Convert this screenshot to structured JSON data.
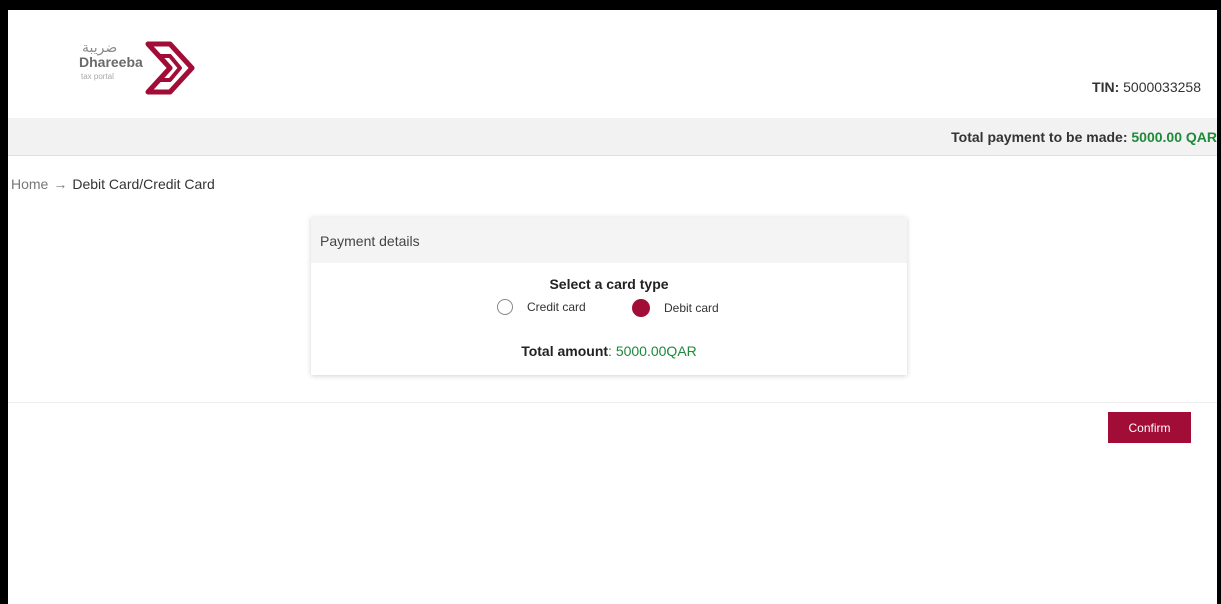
{
  "header": {
    "logo": {
      "arabic": "ضريبة",
      "name": "Dhareeba",
      "subtitle": "tax portal"
    },
    "tin_label": "TIN:",
    "tin_value": "5000033258"
  },
  "payment_bar": {
    "label": "Total payment to be made:",
    "amount": "5000.00 QAR"
  },
  "breadcrumb": {
    "home": "Home",
    "arrow": "→",
    "current": "Debit Card/Credit Card"
  },
  "card": {
    "title": "Payment details",
    "select_title": "Select a card type",
    "options": [
      {
        "label": "Credit card",
        "selected": false
      },
      {
        "label": "Debit card",
        "selected": true
      }
    ],
    "total_label": "Total amount",
    "total_sep": ":",
    "total_value": "5000.00QAR"
  },
  "actions": {
    "confirm_label": "Confirm"
  },
  "colors": {
    "brand": "#a10d36",
    "amount_green": "#1e8a3a"
  }
}
